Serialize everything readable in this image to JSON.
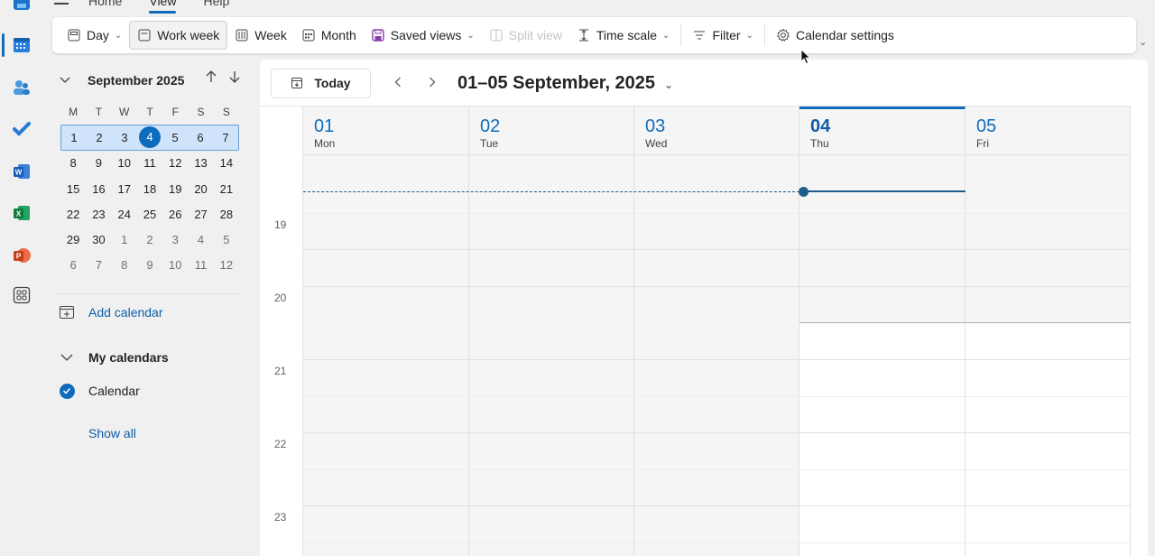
{
  "ribbon": {
    "tabs": [
      "Home",
      "View",
      "Help"
    ],
    "active_tab": "View"
  },
  "toolbar": {
    "day": "Day",
    "work_week": "Work week",
    "week": "Week",
    "month": "Month",
    "saved_views": "Saved views",
    "split_view": "Split view",
    "time_scale": "Time scale",
    "filter": "Filter",
    "calendar_settings": "Calendar settings"
  },
  "mini_calendar": {
    "title": "September 2025",
    "weekdays": [
      "M",
      "T",
      "W",
      "T",
      "F",
      "S",
      "S"
    ],
    "weeks": [
      [
        "1",
        "2",
        "3",
        "4",
        "5",
        "6",
        "7"
      ],
      [
        "8",
        "9",
        "10",
        "11",
        "12",
        "13",
        "14"
      ],
      [
        "15",
        "16",
        "17",
        "18",
        "19",
        "20",
        "21"
      ],
      [
        "22",
        "23",
        "24",
        "25",
        "26",
        "27",
        "28"
      ],
      [
        "29",
        "30",
        "1",
        "2",
        "3",
        "4",
        "5"
      ],
      [
        "6",
        "7",
        "8",
        "9",
        "10",
        "11",
        "12"
      ]
    ],
    "today": "4"
  },
  "left_pane": {
    "add_calendar": "Add calendar",
    "my_calendars": "My calendars",
    "calendar_item": "Calendar",
    "show_all": "Show all"
  },
  "main": {
    "today_button": "Today",
    "range_title": "01–05 September, 2025",
    "days": [
      {
        "num": "01",
        "name": "Mon"
      },
      {
        "num": "02",
        "name": "Tue"
      },
      {
        "num": "03",
        "name": "Wed"
      },
      {
        "num": "04",
        "name": "Thu"
      },
      {
        "num": "05",
        "name": "Fri"
      }
    ],
    "hours": [
      "19",
      "20",
      "21",
      "22",
      "23"
    ]
  },
  "colors": {
    "accent": "#0f6cbd",
    "now_indicator": "#1b5e8c",
    "week_highlight": "#cfe4fa"
  }
}
